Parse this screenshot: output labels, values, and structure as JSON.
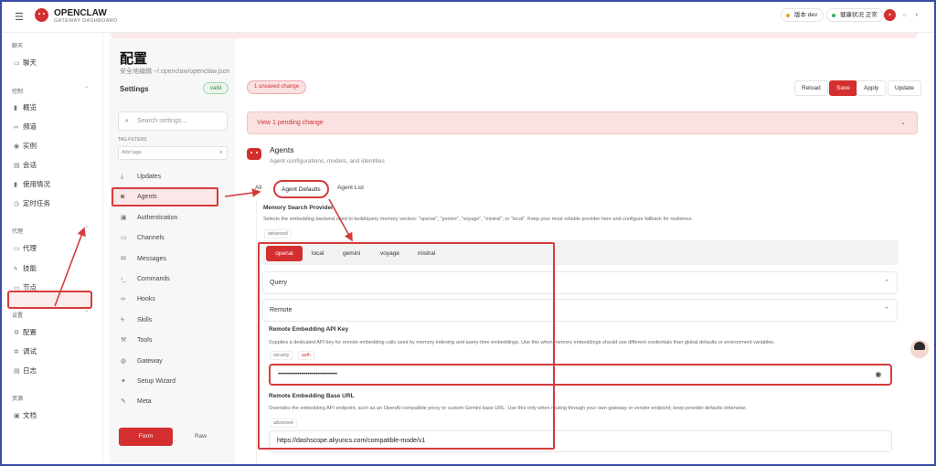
{
  "header": {
    "brand": "OPENCLAW",
    "brand_sub": "GATEWAY DASHBOARD",
    "version_pill": "版本 dev",
    "health_pill": "健康状况 正常"
  },
  "nav": {
    "sections": [
      {
        "label": "聊天",
        "items": [
          {
            "label": "聊天",
            "icon": "chat-icon"
          }
        ]
      },
      {
        "label": "控制",
        "items": [
          {
            "label": "概览",
            "icon": "bar-chart-icon"
          },
          {
            "label": "频道",
            "icon": "link-icon"
          },
          {
            "label": "实例",
            "icon": "radio-icon"
          },
          {
            "label": "会话",
            "icon": "document-icon"
          },
          {
            "label": "使用情况",
            "icon": "bar-chart-icon"
          },
          {
            "label": "定时任务",
            "icon": "clock-icon"
          }
        ]
      },
      {
        "label": "代理",
        "items": [
          {
            "label": "代理",
            "icon": "folder-icon"
          },
          {
            "label": "技能",
            "icon": "zap-icon"
          },
          {
            "label": "节点",
            "icon": "monitor-icon"
          }
        ]
      },
      {
        "label": "设置",
        "items": [
          {
            "label": "配置",
            "icon": "gear-icon"
          },
          {
            "label": "调试",
            "icon": "bug-icon"
          },
          {
            "label": "日志",
            "icon": "file-icon"
          }
        ]
      },
      {
        "label": "资源",
        "items": [
          {
            "label": "文档",
            "icon": "book-icon"
          }
        ]
      }
    ]
  },
  "page": {
    "title": "配置",
    "subtitle": "安全地编辑 ~/.openclaw/openclaw.json"
  },
  "settings": {
    "heading": "Settings",
    "valid_badge": "valid",
    "search_placeholder": "Search settings...",
    "tag_filters_label": "TAG FILTERS",
    "add_tags": "Add tags",
    "items": [
      {
        "label": "Updates",
        "icon": "download-icon"
      },
      {
        "label": "Agents",
        "icon": "robot-icon"
      },
      {
        "label": "Authentication",
        "icon": "lock-icon"
      },
      {
        "label": "Channels",
        "icon": "chat-icon"
      },
      {
        "label": "Messages",
        "icon": "mail-icon"
      },
      {
        "label": "Commands",
        "icon": "terminal-icon"
      },
      {
        "label": "Hooks",
        "icon": "link-icon"
      },
      {
        "label": "Skills",
        "icon": "zap-icon"
      },
      {
        "label": "Tools",
        "icon": "wrench-icon"
      },
      {
        "label": "Gateway",
        "icon": "globe-icon"
      },
      {
        "label": "Setup Wizard",
        "icon": "sparkle-icon"
      },
      {
        "label": "Meta",
        "icon": "pen-icon"
      }
    ],
    "form_label": "Form",
    "raw_label": "Raw"
  },
  "actions": {
    "unsaved": "1 unsaved change",
    "reload": "Reload",
    "save": "Save",
    "apply": "Apply",
    "update": "Update",
    "pending": "View 1 pending change"
  },
  "agents": {
    "title": "Agents",
    "subtitle": "Agent configurations, models, and identities",
    "tabs": [
      "All",
      "Agent Defaults",
      "Agent List"
    ]
  },
  "memory": {
    "title": "Memory Search Provider",
    "description": "Selects the embedding backend used to build/query memory vectors: \"openai\", \"gemini\", \"voyage\", \"mistral\", or \"local\". Keep your most reliable provider here and configure fallback for resilience.",
    "tag": "advanced",
    "providers": [
      "openai",
      "local",
      "gemini",
      "voyage",
      "mistral"
    ],
    "query_label": "Query",
    "remote_label": "Remote",
    "api_key_title": "Remote Embedding API Key",
    "api_key_desc": "Supplies a dedicated API key for remote embedding calls used by memory indexing and query-time embeddings. Use this when memory embeddings should use different credentials than global defaults or environment variables.",
    "api_key_tags": [
      "security",
      "auth"
    ],
    "api_key_value": "••••••••••••••••••••••••••••••••••••",
    "base_url_title": "Remote Embedding Base URL",
    "base_url_desc": "Overrides the embedding API endpoint, such as an OpenAI-compatible proxy or custom Gemini base URL. Use this only when routing through your own gateway or vendor endpoint; keep provider defaults otherwise.",
    "base_url_tag": "advanced",
    "base_url_value": "https://dashscope.aliyuncs.com/compatible-mode/v1"
  },
  "colors": {
    "accent": "#d32f2f",
    "annotation": "#d43c3c",
    "highlight_bg": "#fbe2e2"
  }
}
